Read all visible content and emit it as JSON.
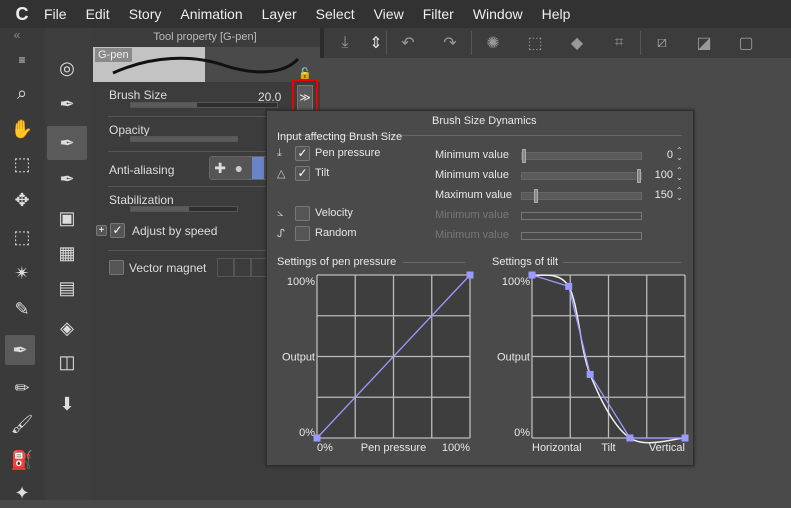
{
  "menu": {
    "logo": "C",
    "items": [
      "File",
      "Edit",
      "Story",
      "Animation",
      "Layer",
      "Select",
      "View",
      "Filter",
      "Window",
      "Help"
    ]
  },
  "panel": {
    "title": "Tool property [G-pen]",
    "preview_label": "G-pen",
    "brush_size_label": "Brush Size",
    "brush_size_value": "20.0",
    "opacity_label": "Opacity",
    "anti_aliasing_label": "Anti-aliasing",
    "stabilization_label": "Stabilization",
    "adjust_by_speed_label": "Adjust by speed",
    "adjust_by_speed_checked": true,
    "vector_magnet_label": "Vector magnet",
    "vector_magnet_checked": false,
    "brush_size_fill": 0.45,
    "opacity_fill": 1.0,
    "stabilization_fill": 0.55
  },
  "popup": {
    "title": "Brush Size Dynamics",
    "input_header": "Input affecting Brush Size",
    "inputs": [
      {
        "label": "Pen pressure",
        "checked": true,
        "param": "Minimum value",
        "value": "0",
        "fill": 0.0,
        "enabled": true
      },
      {
        "label": "Tilt",
        "checked": true,
        "param": "Minimum value",
        "value": "100",
        "fill": 1.0,
        "enabled": true
      },
      {
        "label": "",
        "checked": null,
        "param": "Maximum value",
        "value": "150",
        "fill": 0.1,
        "enabled": true
      },
      {
        "label": "Velocity",
        "checked": false,
        "param": "Minimum value",
        "value": "",
        "enabled": false
      },
      {
        "label": "Random",
        "checked": false,
        "param": "Minimum value",
        "value": "",
        "enabled": false
      }
    ],
    "pressure_graph": {
      "title": "Settings of pen pressure",
      "y_top": "100%",
      "y_mid": "Output",
      "y_bottom": "0%",
      "x_left": "0%",
      "x_mid": "Pen pressure",
      "x_right": "100%",
      "points": [
        [
          0,
          0
        ],
        [
          1,
          1
        ]
      ]
    },
    "tilt_graph": {
      "title": "Settings of tilt",
      "y_top": "100%",
      "y_mid": "Output",
      "y_bottom": "0%",
      "x_left": "Horizontal",
      "x_mid": "Tilt",
      "x_right": "Vertical",
      "points": [
        [
          0,
          1
        ],
        [
          0.24,
          0.93
        ],
        [
          0.38,
          0.39
        ],
        [
          0.64,
          0
        ],
        [
          1,
          0
        ]
      ]
    },
    "curve_color": "#9a9aff"
  }
}
